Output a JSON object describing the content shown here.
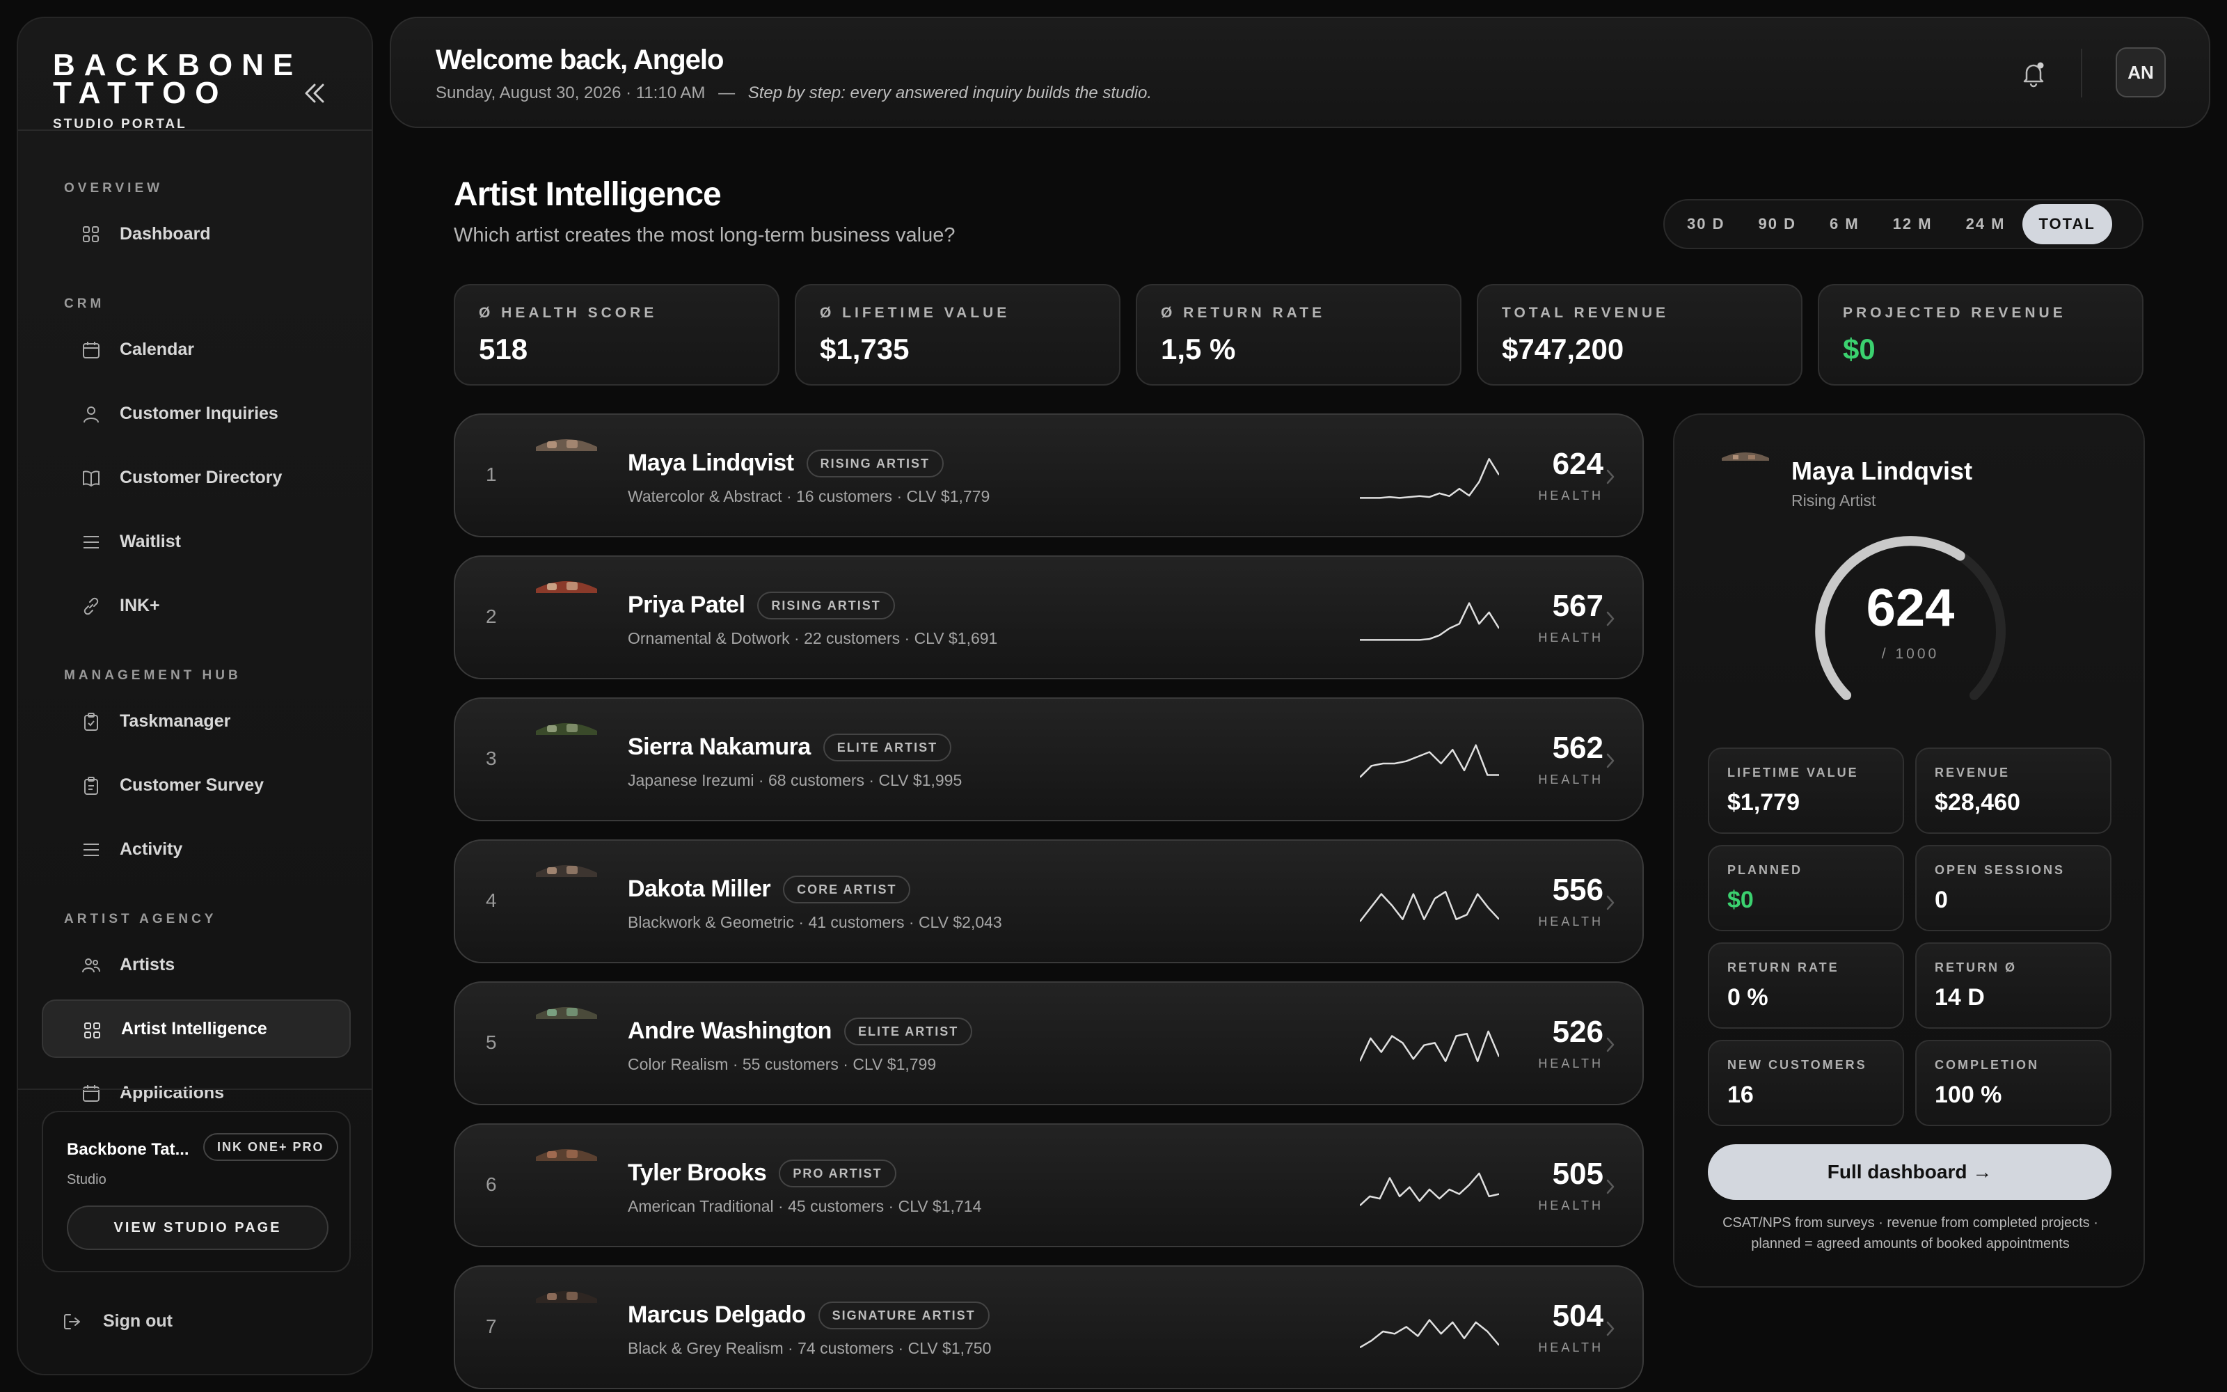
{
  "brand": {
    "line1": "BACKBONE",
    "line2": "TATTOO",
    "sub": "STUDIO PORTAL"
  },
  "sidebar": {
    "sections": [
      {
        "title": "OVERVIEW",
        "items": [
          {
            "label": "Dashboard",
            "icon": "grid-icon"
          }
        ]
      },
      {
        "title": "CRM",
        "items": [
          {
            "label": "Calendar",
            "icon": "calendar-icon"
          },
          {
            "label": "Customer Inquiries",
            "icon": "user-icon"
          },
          {
            "label": "Customer Directory",
            "icon": "book-icon"
          },
          {
            "label": "Waitlist",
            "icon": "list-icon"
          },
          {
            "label": "INK+",
            "icon": "link-icon"
          }
        ]
      },
      {
        "title": "MANAGEMENT HUB",
        "items": [
          {
            "label": "Taskmanager",
            "icon": "clipboard-icon"
          },
          {
            "label": "Customer Survey",
            "icon": "clipboard-icon"
          },
          {
            "label": "Activity",
            "icon": "list-icon"
          }
        ]
      },
      {
        "title": "ARTIST AGENCY",
        "items": [
          {
            "label": "Artists",
            "icon": "users-icon"
          },
          {
            "label": "Artist Intelligence",
            "icon": "grid-icon",
            "active": true
          },
          {
            "label": "Applications",
            "icon": "calendar-icon"
          }
        ]
      }
    ],
    "studio": {
      "name": "Backbone Tat...",
      "badge": "INK ONE+ PRO",
      "type": "Studio",
      "button": "VIEW STUDIO PAGE"
    },
    "signout": "Sign out"
  },
  "header": {
    "welcome": "Welcome back, Angelo",
    "date": "Sunday, August 30, 2026 · 11:10 AM",
    "sep": "—",
    "quote": "Step by step: every answered inquiry builds the studio.",
    "avatar": "AN"
  },
  "page": {
    "title": "Artist Intelligence",
    "subtitle": "Which artist creates the most long-term business value?"
  },
  "ranges": [
    {
      "label": "30 D"
    },
    {
      "label": "90 D"
    },
    {
      "label": "6 M"
    },
    {
      "label": "12 M"
    },
    {
      "label": "24 M"
    },
    {
      "label": "TOTAL",
      "selected": true
    }
  ],
  "kpis": [
    {
      "label": "Ø HEALTH SCORE",
      "value": "518"
    },
    {
      "label": "Ø LIFETIME VALUE",
      "value": "$1,735"
    },
    {
      "label": "Ø RETURN RATE",
      "value": "1,5 %"
    },
    {
      "label": "TOTAL REVENUE",
      "value": "$747,200"
    },
    {
      "label": "PROJECTED REVENUE",
      "value": "$0",
      "color": "#3bd16f"
    }
  ],
  "health_label": "HEALTH",
  "artists": [
    {
      "rank": "1",
      "name": "Maya Lindqvist",
      "badge": "RISING ARTIST",
      "meta": "Watercolor & Abstract · 16 customers · CLV $1,779",
      "score": "624",
      "trend": [
        0.1,
        0.1,
        0.1,
        0.12,
        0.1,
        0.12,
        0.14,
        0.12,
        0.2,
        0.14,
        0.3,
        0.15,
        0.45,
        0.95,
        0.6
      ]
    },
    {
      "rank": "2",
      "name": "Priya Patel",
      "badge": "RISING ARTIST",
      "meta": "Ornamental & Dotwork · 22 customers · CLV $1,691",
      "score": "567",
      "trend": [
        0.1,
        0.1,
        0.1,
        0.1,
        0.1,
        0.1,
        0.1,
        0.12,
        0.2,
        0.35,
        0.45,
        0.9,
        0.45,
        0.7,
        0.35
      ]
    },
    {
      "rank": "3",
      "name": "Sierra Nakamura",
      "badge": "ELITE ARTIST",
      "meta": "Japanese Irezumi · 68 customers · CLV $1,995",
      "score": "562",
      "trend": [
        0.2,
        0.45,
        0.5,
        0.5,
        0.55,
        0.65,
        0.75,
        0.5,
        0.8,
        0.35,
        0.9,
        0.25,
        0.25
      ]
    },
    {
      "rank": "4",
      "name": "Dakota Miller",
      "badge": "CORE ARTIST",
      "meta": "Blackwork & Geometric · 41 customers · CLV $2,043",
      "score": "556",
      "trend": [
        0.15,
        0.45,
        0.75,
        0.5,
        0.2,
        0.75,
        0.2,
        0.65,
        0.8,
        0.2,
        0.3,
        0.75,
        0.45,
        0.2
      ]
    },
    {
      "rank": "5",
      "name": "Andre Washington",
      "badge": "ELITE ARTIST",
      "meta": "Color Realism · 55 customers · CLV $1,799",
      "score": "526",
      "trend": [
        0.2,
        0.7,
        0.4,
        0.75,
        0.6,
        0.25,
        0.55,
        0.6,
        0.2,
        0.75,
        0.8,
        0.2,
        0.85,
        0.3
      ]
    },
    {
      "rank": "6",
      "name": "Tyler Brooks",
      "badge": "PRO ARTIST",
      "meta": "American Traditional · 45 customers · CLV $1,714",
      "score": "505",
      "trend": [
        0.15,
        0.35,
        0.3,
        0.75,
        0.35,
        0.55,
        0.25,
        0.5,
        0.3,
        0.5,
        0.4,
        0.6,
        0.85,
        0.35,
        0.4
      ]
    },
    {
      "rank": "7",
      "name": "Marcus Delgado",
      "badge": "SIGNATURE ARTIST",
      "meta": "Black & Grey Realism · 74 customers · CLV $1,750",
      "score": "504",
      "trend": [
        0.15,
        0.3,
        0.5,
        0.45,
        0.6,
        0.4,
        0.75,
        0.45,
        0.7,
        0.35,
        0.7,
        0.5,
        0.2
      ]
    }
  ],
  "detail": {
    "name": "Maya Lindqvist",
    "tier": "Rising Artist",
    "score": "624",
    "score_value": 624,
    "score_max": 1000,
    "max": "/ 1000",
    "stats": [
      {
        "label": "LIFETIME VALUE",
        "value": "$1,779"
      },
      {
        "label": "REVENUE",
        "value": "$28,460"
      },
      {
        "label": "PLANNED",
        "value": "$0",
        "color": "#3bd16f"
      },
      {
        "label": "OPEN SESSIONS",
        "value": "0"
      },
      {
        "label": "RETURN RATE",
        "value": "0 %"
      },
      {
        "label": "RETURN Ø",
        "value": "14 D"
      },
      {
        "label": "NEW CUSTOMERS",
        "value": "16"
      },
      {
        "label": "COMPLETION",
        "value": "100 %"
      }
    ],
    "button": "Full dashboard →",
    "note1": "CSAT/NPS from surveys · revenue from completed projects ·",
    "note2": "planned = agreed amounts of booked appointments"
  }
}
